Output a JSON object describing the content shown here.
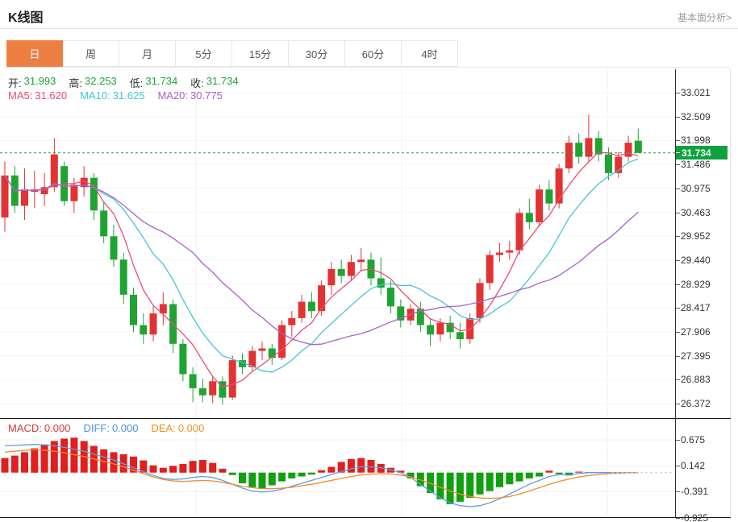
{
  "header": {
    "title": "K线图",
    "link": "基本面分析>"
  },
  "tabs": [
    {
      "label": "日",
      "active": true
    },
    {
      "label": "周",
      "active": false
    },
    {
      "label": "月",
      "active": false
    },
    {
      "label": "5分",
      "active": false
    },
    {
      "label": "15分",
      "active": false
    },
    {
      "label": "30分",
      "active": false
    },
    {
      "label": "60分",
      "active": false
    },
    {
      "label": "4时",
      "active": false
    }
  ],
  "legend_ohlc": [
    {
      "label": "开:",
      "value": "31.993"
    },
    {
      "label": "高:",
      "value": "32.253"
    },
    {
      "label": "低:",
      "value": "31.734"
    },
    {
      "label": "收:",
      "value": "31.734"
    }
  ],
  "legend_ma": [
    {
      "label": "MA5:",
      "value": "31.620",
      "color": "#ef4a77"
    },
    {
      "label": "MA10:",
      "value": "31.625",
      "color": "#45c5d8"
    },
    {
      "label": "MA20:",
      "value": "30.775",
      "color": "#a961c9"
    }
  ],
  "legend_macd": [
    {
      "label": "MACD:",
      "value": "0.000",
      "color": "#e03535"
    },
    {
      "label": "DIFF:",
      "value": "0.000",
      "color": "#4a90e2"
    },
    {
      "label": "DEA:",
      "value": "0.000",
      "color": "#f5901e"
    }
  ],
  "axis": {
    "price_tag": "31.734"
  },
  "colors": {
    "accent_orange": "#ee7f43",
    "up_red": "#e23333",
    "down_green": "#1fa433",
    "macd_red": "#e01f1f",
    "macd_green": "#10a010",
    "text_green": "#1ea33c",
    "label_dark": "#333333",
    "ma5_pink": "#ef4a77",
    "ma10_cyan": "#45c5d8",
    "ma20_purple": "#a961c9",
    "diff_blue": "#5b9fe0",
    "dea_orange": "#ef8a2e",
    "price_line_green": "#16a345",
    "tag_green": "#0da23e",
    "zero_dash_blue": "#aad4f2"
  },
  "chart_data": {
    "type": "candlestick+macd",
    "title": "K线图",
    "convention": "red = up, green = down",
    "price_panel": {
      "y_ticks": [
        33.021,
        32.509,
        31.998,
        31.486,
        30.975,
        30.463,
        29.952,
        29.44,
        28.929,
        28.417,
        27.906,
        27.395,
        26.883,
        26.372
      ],
      "price_line": 31.734,
      "ohlc_display": {
        "open": 31.993,
        "high": 32.253,
        "low": 31.734,
        "close": 31.734
      },
      "ma_display": {
        "MA5": 31.62,
        "MA10": 31.625,
        "MA20": 30.775
      },
      "ma_periods": [
        5,
        10,
        20
      ],
      "candles": [
        [
          30.35,
          31.55,
          30.05,
          31.25
        ],
        [
          31.25,
          31.45,
          30.45,
          30.6
        ],
        [
          30.6,
          31.4,
          30.3,
          30.95
        ],
        [
          30.9,
          31.35,
          30.55,
          30.95
        ],
        [
          30.85,
          31.3,
          30.6,
          31.0
        ],
        [
          31.0,
          32.05,
          30.9,
          31.7
        ],
        [
          31.45,
          31.55,
          30.6,
          30.7
        ],
        [
          30.7,
          31.2,
          30.45,
          31.05
        ],
        [
          31.0,
          31.45,
          30.8,
          31.2
        ],
        [
          31.2,
          31.3,
          30.3,
          30.5
        ],
        [
          30.5,
          30.7,
          29.8,
          29.95
        ],
        [
          29.95,
          30.2,
          29.3,
          29.45
        ],
        [
          29.45,
          29.6,
          28.5,
          28.7
        ],
        [
          28.7,
          28.85,
          27.9,
          28.05
        ],
        [
          28.05,
          28.3,
          27.65,
          27.85
        ],
        [
          27.85,
          28.45,
          27.7,
          28.3
        ],
        [
          28.3,
          28.75,
          28.05,
          28.5
        ],
        [
          28.5,
          28.6,
          27.45,
          27.65
        ],
        [
          27.65,
          27.75,
          26.85,
          27.0
        ],
        [
          27.0,
          27.15,
          26.4,
          26.7
        ],
        [
          26.7,
          26.9,
          26.4,
          26.55
        ],
        [
          26.55,
          26.95,
          26.38,
          26.85
        ],
        [
          26.85,
          26.95,
          26.35,
          26.5
        ],
        [
          26.5,
          27.4,
          26.45,
          27.3
        ],
        [
          27.3,
          27.45,
          27.0,
          27.15
        ],
        [
          27.15,
          27.6,
          27.05,
          27.5
        ],
        [
          27.5,
          27.7,
          27.3,
          27.55
        ],
        [
          27.55,
          27.65,
          27.2,
          27.35
        ],
        [
          27.35,
          28.15,
          27.3,
          28.05
        ],
        [
          28.05,
          28.35,
          27.8,
          28.2
        ],
        [
          28.2,
          28.7,
          28.1,
          28.55
        ],
        [
          28.55,
          28.75,
          28.2,
          28.35
        ],
        [
          28.35,
          29.0,
          28.25,
          28.9
        ],
        [
          28.9,
          29.4,
          28.7,
          29.25
        ],
        [
          29.25,
          29.45,
          28.95,
          29.1
        ],
        [
          29.1,
          29.55,
          29.0,
          29.4
        ],
        [
          29.4,
          29.7,
          29.2,
          29.45
        ],
        [
          29.45,
          29.6,
          28.9,
          29.05
        ],
        [
          29.05,
          29.5,
          28.7,
          28.85
        ],
        [
          28.85,
          29.0,
          28.3,
          28.45
        ],
        [
          28.45,
          28.6,
          28.0,
          28.15
        ],
        [
          28.15,
          28.5,
          28.05,
          28.4
        ],
        [
          28.4,
          28.55,
          27.9,
          28.05
        ],
        [
          28.05,
          28.2,
          27.6,
          27.85
        ],
        [
          27.85,
          28.2,
          27.7,
          28.1
        ],
        [
          28.1,
          28.25,
          27.75,
          27.9
        ],
        [
          27.9,
          28.1,
          27.55,
          27.75
        ],
        [
          27.75,
          28.3,
          27.65,
          28.2
        ],
        [
          28.2,
          29.05,
          28.1,
          28.95
        ],
        [
          28.95,
          29.65,
          28.8,
          29.55
        ],
        [
          29.55,
          29.8,
          29.4,
          29.6
        ],
        [
          29.6,
          29.85,
          29.45,
          29.65
        ],
        [
          29.65,
          30.55,
          29.55,
          30.45
        ],
        [
          30.45,
          30.75,
          30.1,
          30.25
        ],
        [
          30.25,
          31.05,
          30.15,
          30.95
        ],
        [
          30.95,
          31.15,
          30.5,
          30.65
        ],
        [
          30.65,
          31.5,
          30.55,
          31.4
        ],
        [
          31.4,
          32.1,
          31.3,
          31.95
        ],
        [
          31.95,
          32.15,
          31.5,
          31.65
        ],
        [
          31.65,
          32.55,
          31.55,
          32.05
        ],
        [
          32.05,
          32.2,
          31.55,
          31.7
        ],
        [
          31.7,
          31.85,
          31.15,
          31.3
        ],
        [
          31.3,
          31.75,
          31.2,
          31.65
        ],
        [
          31.65,
          32.1,
          31.55,
          31.95
        ],
        [
          31.993,
          32.253,
          31.734,
          31.734
        ]
      ]
    },
    "macd_panel": {
      "y_ticks": [
        0.675,
        0.142,
        -0.391,
        -0.925
      ],
      "display": {
        "MACD": 0.0,
        "DIFF": 0.0,
        "DEA": 0.0
      },
      "histogram": [
        0.3,
        0.35,
        0.42,
        0.5,
        0.58,
        0.65,
        0.7,
        0.72,
        0.65,
        0.55,
        0.48,
        0.42,
        0.38,
        0.33,
        0.25,
        0.15,
        0.1,
        0.14,
        0.18,
        0.24,
        0.26,
        0.2,
        0.08,
        -0.05,
        -0.22,
        -0.3,
        -0.32,
        -0.26,
        -0.18,
        -0.12,
        -0.08,
        -0.04,
        0.05,
        0.12,
        0.22,
        0.28,
        0.3,
        0.26,
        0.18,
        0.1,
        0.04,
        -0.12,
        -0.28,
        -0.42,
        -0.55,
        -0.65,
        -0.6,
        -0.52,
        -0.45,
        -0.38,
        -0.3,
        -0.24,
        -0.18,
        -0.12,
        -0.08,
        0.04,
        -0.03,
        -0.06,
        0.02,
        0.01,
        0.005,
        0.002,
        0.001,
        0.0,
        0.0
      ],
      "diff": [
        0.55,
        0.56,
        0.57,
        0.58,
        0.57,
        0.55,
        0.52,
        0.48,
        0.44,
        0.38,
        0.32,
        0.26,
        0.18,
        0.1,
        0.02,
        -0.06,
        -0.12,
        -0.14,
        -0.13,
        -0.1,
        -0.08,
        -0.1,
        -0.16,
        -0.24,
        -0.32,
        -0.38,
        -0.4,
        -0.38,
        -0.34,
        -0.28,
        -0.22,
        -0.16,
        -0.1,
        -0.04,
        0.02,
        0.08,
        0.12,
        0.12,
        0.1,
        0.06,
        0.0,
        -0.1,
        -0.24,
        -0.38,
        -0.52,
        -0.62,
        -0.68,
        -0.7,
        -0.68,
        -0.62,
        -0.54,
        -0.44,
        -0.34,
        -0.24,
        -0.16,
        -0.08,
        -0.04,
        -0.04,
        -0.02,
        0.0,
        0.0,
        0.0,
        0.0,
        0.0,
        0.0
      ],
      "dea": [
        0.42,
        0.44,
        0.46,
        0.47,
        0.46,
        0.44,
        0.41,
        0.37,
        0.33,
        0.28,
        0.23,
        0.18,
        0.12,
        0.05,
        -0.02,
        -0.09,
        -0.14,
        -0.17,
        -0.18,
        -0.17,
        -0.16,
        -0.17,
        -0.2,
        -0.24,
        -0.28,
        -0.31,
        -0.33,
        -0.33,
        -0.32,
        -0.3,
        -0.27,
        -0.24,
        -0.2,
        -0.16,
        -0.12,
        -0.08,
        -0.05,
        -0.03,
        -0.02,
        -0.03,
        -0.05,
        -0.09,
        -0.15,
        -0.22,
        -0.3,
        -0.38,
        -0.44,
        -0.49,
        -0.52,
        -0.53,
        -0.52,
        -0.49,
        -0.44,
        -0.38,
        -0.31,
        -0.24,
        -0.18,
        -0.13,
        -0.09,
        -0.06,
        -0.04,
        -0.02,
        -0.01,
        -0.005,
        0.0
      ]
    }
  }
}
